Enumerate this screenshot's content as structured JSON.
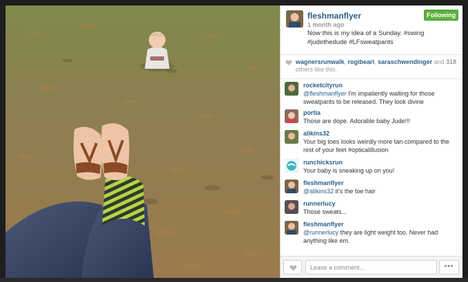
{
  "post": {
    "owner": "fleshmanflyer",
    "age": "1 month ago",
    "caption": "Now this is my idea of a Sunday. #swing #judethedude #LFsweatpants",
    "follow_label": "Following",
    "follow_color": "#5cb23d"
  },
  "likes": {
    "users": [
      "wagnersrunwalk",
      "rogibeari",
      "saraschwendinger"
    ],
    "and_text": " and ",
    "count": "318",
    "suffix": "others like this."
  },
  "comments": [
    {
      "user": "rocketcityrun",
      "mention": "@fleshmanflyer",
      "text": " I'm impatiently waiting for those sweatpants to be released. They look divine"
    },
    {
      "user": "portia",
      "mention": "",
      "text": "Those are dope. Adorable baby Jude!!!"
    },
    {
      "user": "alikins32",
      "mention": "",
      "text": "Your big toes looks weirdly more tan compared to the rest of your feet #opticalillusion"
    },
    {
      "user": "runchicksrun",
      "mention": "",
      "text": "Your baby is sneaking up on you!"
    },
    {
      "user": "fleshmanflyer",
      "mention": "@alikins32",
      "text": " it's the toe hair"
    },
    {
      "user": "runnerlucy",
      "mention": "",
      "text": "Those sweats..."
    },
    {
      "user": "fleshmanflyer",
      "mention": "@runnerlucy",
      "text": " they are light weight too. Never had anything like em."
    }
  ],
  "compose": {
    "placeholder": "Leave a comment...",
    "more_label": "•••"
  },
  "icons": {
    "heart": "heart-icon",
    "more": "more-dots-icon"
  }
}
